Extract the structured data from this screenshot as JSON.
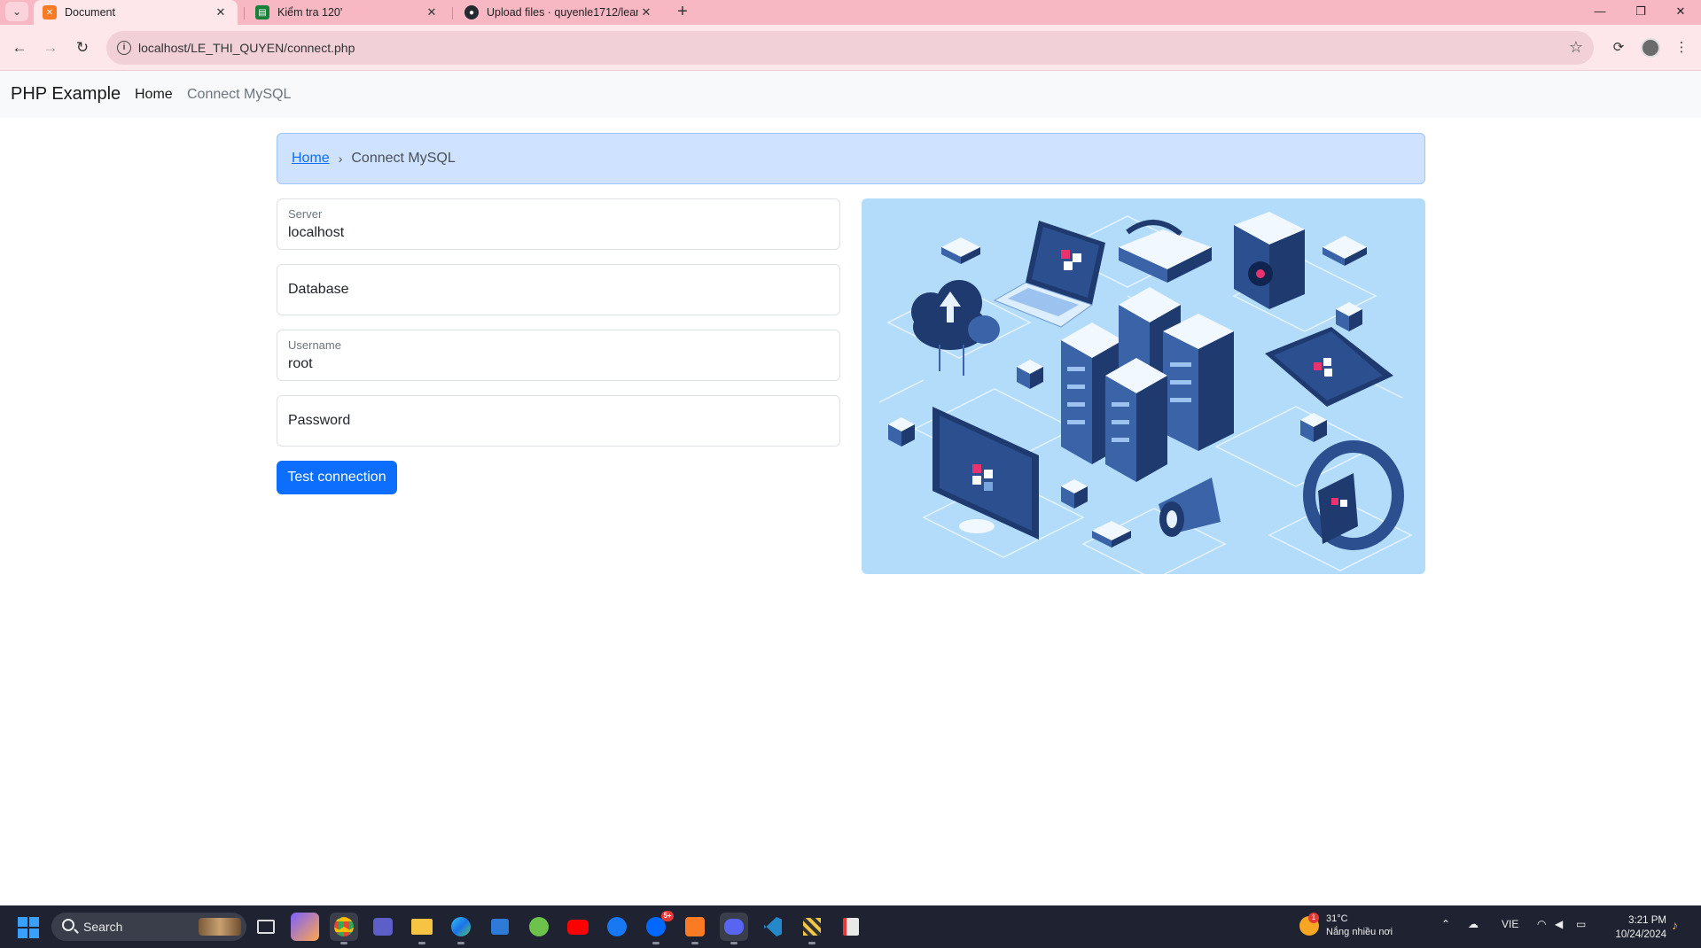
{
  "browser": {
    "tabs": [
      {
        "title": "Document",
        "icon": "xampp-icon",
        "color": "#fb7a24"
      },
      {
        "title": "Kiểm tra 120'",
        "icon": "sheets-icon",
        "color": "#188038"
      },
      {
        "title": "Upload files · quyenle1712/lear",
        "icon": "github-icon",
        "color": "#24292f"
      }
    ],
    "new_tab": "+",
    "url": "localhost/LE_THI_QUYEN/connect.php"
  },
  "navbar": {
    "brand": "PHP Example",
    "links": [
      "Home",
      "Connect MySQL"
    ]
  },
  "breadcrumb": {
    "home": "Home",
    "separator": "›",
    "current": "Connect MySQL"
  },
  "form": {
    "server": {
      "label": "Server",
      "value": "localhost"
    },
    "database": {
      "label": "Database",
      "value": ""
    },
    "username": {
      "label": "Username",
      "value": "root"
    },
    "password": {
      "label": "Password",
      "value": ""
    },
    "submit": "Test connection"
  },
  "illustration": {
    "background": "#b3dcfb",
    "accent": "#1e3a6e",
    "highlight": "#e8336e"
  },
  "taskbar": {
    "search": "Search",
    "weather": {
      "temp": "31°C",
      "desc": "Nắng nhiều nơi",
      "badge": "1"
    },
    "language": "VIE",
    "time": "3:21 PM",
    "date": "10/24/2024",
    "chat_badge": "5+"
  }
}
